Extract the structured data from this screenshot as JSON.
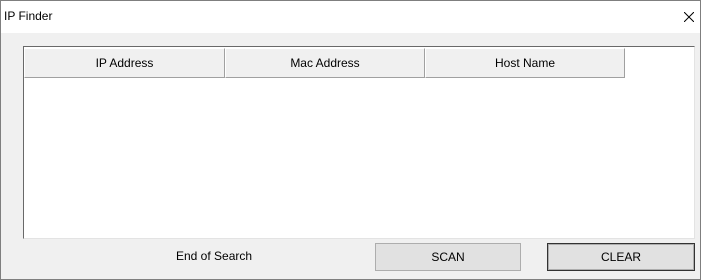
{
  "window": {
    "title": "IP Finder"
  },
  "listview": {
    "columns": [
      {
        "label": "IP Address"
      },
      {
        "label": "Mac Address"
      },
      {
        "label": "Host Name"
      }
    ],
    "rows": []
  },
  "status": {
    "text": "End of Search"
  },
  "buttons": {
    "scan_label": "SCAN",
    "clear_label": "CLEAR"
  },
  "icons": {
    "close": "close-icon"
  },
  "colors": {
    "window_bg": "#f0f0f0",
    "titlebar_bg": "#ffffff",
    "button_bg": "#e1e1e1"
  }
}
